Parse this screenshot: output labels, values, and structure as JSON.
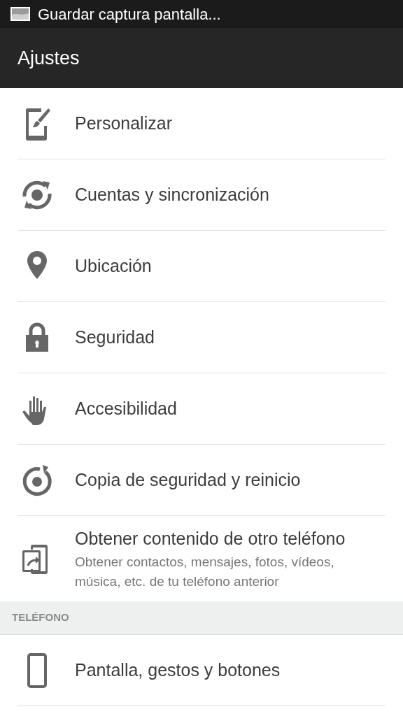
{
  "status_bar": {
    "notification": "Guardar captura pantalla..."
  },
  "header": {
    "title": "Ajustes"
  },
  "items": [
    {
      "kind": "row",
      "title": "Personalizar"
    },
    {
      "kind": "row",
      "title": "Cuentas y sincronización"
    },
    {
      "kind": "row",
      "title": "Ubicación"
    },
    {
      "kind": "row",
      "title": "Seguridad"
    },
    {
      "kind": "row",
      "title": "Accesibilidad"
    },
    {
      "kind": "row",
      "title": "Copia de seguridad y reinicio"
    },
    {
      "kind": "row",
      "title": "Obtener contenido de otro teléfono",
      "subtitle": "Obtener contactos, mensajes, fotos, vídeos, música, etc. de tu teléfono anterior"
    },
    {
      "kind": "section",
      "title": "TELÉFONO"
    },
    {
      "kind": "row",
      "title": "Pantalla, gestos y botones"
    }
  ]
}
